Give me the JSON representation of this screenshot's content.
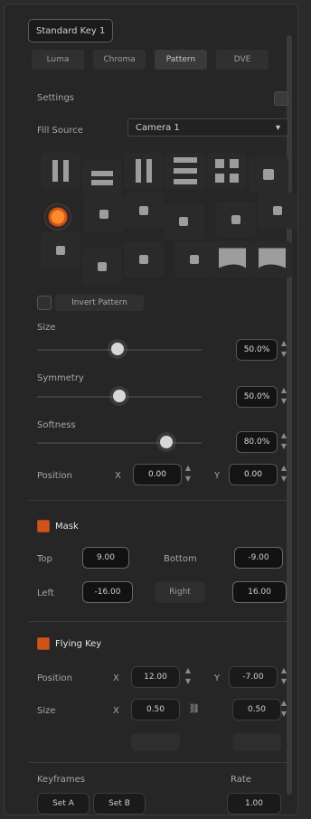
{
  "header": {
    "title": "Standard Key 1"
  },
  "tabs": [
    {
      "label": "Luma",
      "active": false
    },
    {
      "label": "Chroma",
      "active": false
    },
    {
      "label": "Pattern",
      "active": true
    },
    {
      "label": "DVE",
      "active": false
    }
  ],
  "settings": {
    "label": "Settings",
    "fill_source_label": "Fill Source",
    "fill_source_value": "Camera 1",
    "invert_pattern_label": "Invert Pattern"
  },
  "sliders": [
    {
      "label": "Size",
      "value": "50.0%",
      "fraction": 0.5
    },
    {
      "label": "Symmetry",
      "value": "50.0%",
      "fraction": 0.5
    },
    {
      "label": "Softness",
      "value": "80.0%",
      "fraction": 0.8
    }
  ],
  "position": {
    "label": "Position",
    "x_prefix": "X",
    "x_value": "0.00",
    "y_prefix": "Y",
    "y_value": "0.00"
  },
  "mask": {
    "title": "Mask",
    "top_label": "Top",
    "top_value": "9.00",
    "bottom_label": "Bottom",
    "bottom_value": "-9.00",
    "left_label": "Left",
    "left_value": "-16.00",
    "right_label": "Right",
    "right_value": "16.00"
  },
  "flying_key": {
    "title": "Flying Key",
    "position_label": "Position",
    "position_x_prefix": "X",
    "position_x_value": "12.00",
    "position_y_prefix": "Y",
    "position_y_value": "-7.00",
    "size_label": "Size",
    "size_x_prefix": "X",
    "size_x_value": "0.50",
    "size_y_value": "0.50"
  },
  "footer": {
    "keyframes_label": "Keyframes",
    "rate_label": "Rate",
    "set_a_label": "Set A",
    "set_b_label": "Set B",
    "rate_value": "1.00"
  },
  "colors": {
    "background": "#262626",
    "accent": "#d0531a"
  }
}
